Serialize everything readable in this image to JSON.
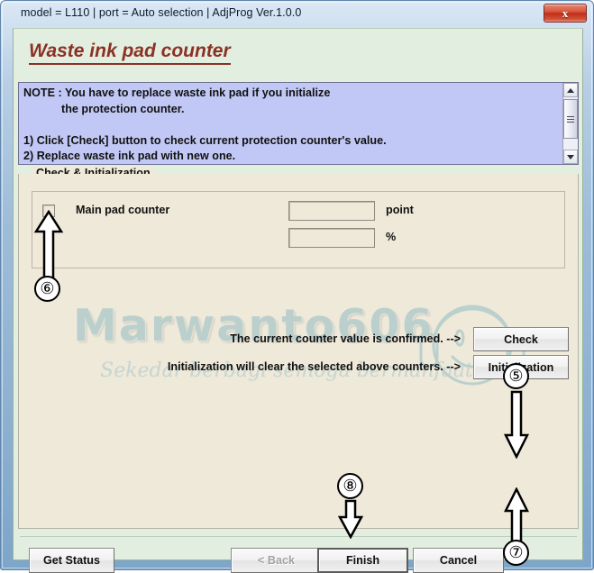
{
  "window": {
    "title": "model = L110 | port = Auto selection | AdjProg Ver.1.0.0",
    "close_label": "x"
  },
  "page": {
    "title": "Waste ink pad counter"
  },
  "note": {
    "text": "NOTE : You have to replace waste ink pad if you initialize\n            the protection counter.\n\n1) Click [Check] button to check current protection counter's value.\n2) Replace waste ink pad with new one."
  },
  "group": {
    "label": "Check & Initialization",
    "checkbox_label": "Main pad counter",
    "point_value": "",
    "point_unit": "point",
    "percent_value": "",
    "percent_unit": "%"
  },
  "actions": {
    "confirm_text": "The current counter value is confirmed. -->",
    "init_text": "Initialization will clear the selected above counters. -->",
    "check_label": "Check",
    "initialization_label": "Initialization"
  },
  "footer": {
    "get_status_label": "Get Status",
    "back_label": "< Back",
    "finish_label": "Finish",
    "cancel_label": "Cancel"
  },
  "watermark": {
    "main": "Marwanto606",
    "sub": "Sekedar berbagi semoga bermanfaat"
  },
  "annotations": {
    "step5": "⑤",
    "step6": "⑥",
    "step7": "⑦",
    "step8": "⑧"
  },
  "colors": {
    "heading": "#8a3223",
    "note_bg": "#c2c8f5",
    "panel_bg": "#efe9d9",
    "client_bg": "#e2eee0",
    "frame": "#8fb2d2",
    "close_red": "#c02d18",
    "watermark": "#b9cfcd"
  }
}
